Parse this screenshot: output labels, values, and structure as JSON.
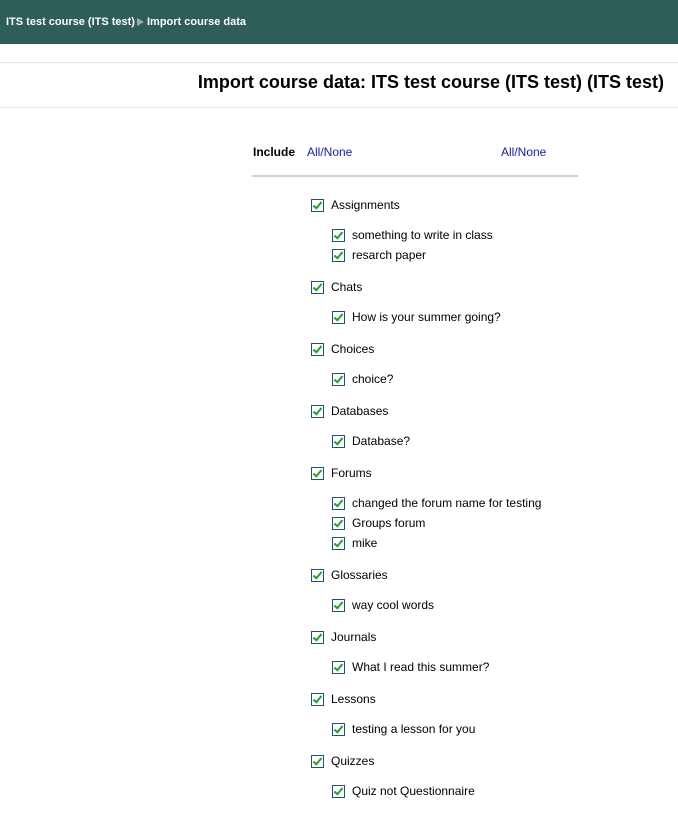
{
  "breadcrumb": {
    "course": "ITS test course (ITS test)",
    "current": "Import course data"
  },
  "page_title": "Import course data: ITS test course (ITS test) (ITS test)",
  "include": {
    "label": "Include",
    "all_none_left": "All/None",
    "all_none_right": "All/None"
  },
  "modules": [
    {
      "name": "Assignments",
      "checked": true,
      "items": [
        {
          "name": "something to write in class",
          "checked": true
        },
        {
          "name": "resarch paper",
          "checked": true
        }
      ]
    },
    {
      "name": "Chats",
      "checked": true,
      "items": [
        {
          "name": "How is your summer going?",
          "checked": true
        }
      ]
    },
    {
      "name": "Choices",
      "checked": true,
      "items": [
        {
          "name": "choice?",
          "checked": true
        }
      ]
    },
    {
      "name": "Databases",
      "checked": true,
      "items": [
        {
          "name": "Database?",
          "checked": true
        }
      ]
    },
    {
      "name": "Forums",
      "checked": true,
      "items": [
        {
          "name": "changed the forum name for testing",
          "checked": true
        },
        {
          "name": "Groups forum",
          "checked": true
        },
        {
          "name": "mike",
          "checked": true
        }
      ]
    },
    {
      "name": "Glossaries",
      "checked": true,
      "items": [
        {
          "name": "way cool words",
          "checked": true
        }
      ]
    },
    {
      "name": "Journals",
      "checked": true,
      "items": [
        {
          "name": "What I read this summer?",
          "checked": true
        }
      ]
    },
    {
      "name": "Lessons",
      "checked": true,
      "items": [
        {
          "name": "testing a lesson for you",
          "checked": true
        }
      ]
    },
    {
      "name": "Quizzes",
      "checked": true,
      "items": [
        {
          "name": "Quiz not Questionnaire",
          "checked": true
        }
      ]
    }
  ]
}
